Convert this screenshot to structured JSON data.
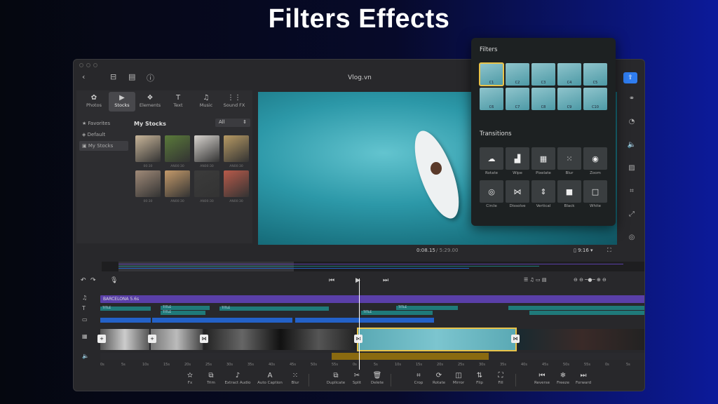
{
  "headline": "Filters Effects",
  "window": {
    "title": "Vlog.vn"
  },
  "media_tabs": [
    {
      "icon": "photos-icon",
      "glyph": "✿",
      "label": "Photos"
    },
    {
      "icon": "stocks-icon",
      "glyph": "▶",
      "label": "Stocks",
      "active": true
    },
    {
      "icon": "elements-icon",
      "glyph": "❖",
      "label": "Elements"
    },
    {
      "icon": "text-icon",
      "glyph": "T",
      "label": "Text"
    },
    {
      "icon": "music-icon",
      "glyph": "♫",
      "label": "Music"
    },
    {
      "icon": "sound-fx-icon",
      "glyph": "⋮⋮",
      "label": "Sound FX"
    }
  ],
  "library": {
    "items": [
      {
        "label": "Favorites",
        "glyph": "★"
      },
      {
        "label": "Default",
        "glyph": "◈"
      },
      {
        "label": "My Stocks",
        "glyph": "▣",
        "selected": true
      }
    ],
    "heading": "My Stocks",
    "filter_value": "All",
    "thumbs": [
      {
        "label": "00:30",
        "color": "#c9b69a"
      },
      {
        "label": "AN00:30",
        "color": "#5a7a3a"
      },
      {
        "label": "AN00:30",
        "color": "#d8d4cf"
      },
      {
        "label": "AN00:30",
        "color": "#b79a64"
      },
      {
        "label": "00:30",
        "color": "#a08a78"
      },
      {
        "label": "AN00:30",
        "color": "#c49a6a"
      },
      {
        "label": "AN00:30",
        "color": "#3b3b3b"
      },
      {
        "label": "AN00:30",
        "color": "#b85a4a"
      }
    ]
  },
  "preview": {
    "current_time": "0:08.15",
    "total_time": "/ 5:29.00",
    "ratio": "9:16 ▾"
  },
  "tracks": {
    "audio_label": "BARCELONA",
    "audio_dur": "5.6s",
    "title_clip": "TITLE",
    "ruler": [
      "0s",
      "5s",
      "10s",
      "15s",
      "20s",
      "25s",
      "30s",
      "35s",
      "40s",
      "45s",
      "50s",
      "55s",
      "0s",
      "5s",
      "10s",
      "15s",
      "20s",
      "25s",
      "30s",
      "35s",
      "40s",
      "45s",
      "50s",
      "55s",
      "0s",
      "5s"
    ]
  },
  "bottom_tools": [
    {
      "label": "Fx",
      "glyph": "✫"
    },
    {
      "label": "Trim",
      "glyph": "⧉"
    },
    {
      "label": "Extract Audio",
      "glyph": "♪"
    },
    {
      "label": "Auto Caption",
      "glyph": "A"
    },
    {
      "label": "Blur",
      "glyph": "⁙"
    },
    {
      "label": "Duplicate",
      "glyph": "⧉"
    },
    {
      "label": "Split",
      "glyph": "✂"
    },
    {
      "label": "Delete",
      "glyph": "🗑"
    },
    {
      "label": "Crop",
      "glyph": "⌗"
    },
    {
      "label": "Rotate",
      "glyph": "⟳"
    },
    {
      "label": "Mirror",
      "glyph": "◫"
    },
    {
      "label": "Flip",
      "glyph": "⇅"
    },
    {
      "label": "Fill",
      "glyph": "⛶"
    },
    {
      "label": "Reverse",
      "glyph": "⏮"
    },
    {
      "label": "Freeze",
      "glyph": "❄"
    },
    {
      "label": "Forward",
      "glyph": "⏭"
    }
  ],
  "filters_panel": {
    "filters_heading": "Filters",
    "filters": [
      "C1",
      "C2",
      "C3",
      "C4",
      "C5",
      "C6",
      "C7",
      "C8",
      "C9",
      "C10"
    ],
    "selected_filter": "C1",
    "transitions_heading": "Transitions",
    "transitions": [
      {
        "label": "Rotate",
        "glyph": "☁"
      },
      {
        "label": "Wipe",
        "glyph": "▟"
      },
      {
        "label": "Pixelate",
        "glyph": "▦"
      },
      {
        "label": "Blur",
        "glyph": "⁙"
      },
      {
        "label": "Zoom",
        "glyph": "◉"
      },
      {
        "label": "Circle",
        "glyph": "◎"
      },
      {
        "label": "Dissolve",
        "glyph": "⋈"
      },
      {
        "label": "Vertical",
        "glyph": "⇕"
      },
      {
        "label": "Black",
        "glyph": "■"
      },
      {
        "label": "White",
        "glyph": "□"
      }
    ]
  }
}
